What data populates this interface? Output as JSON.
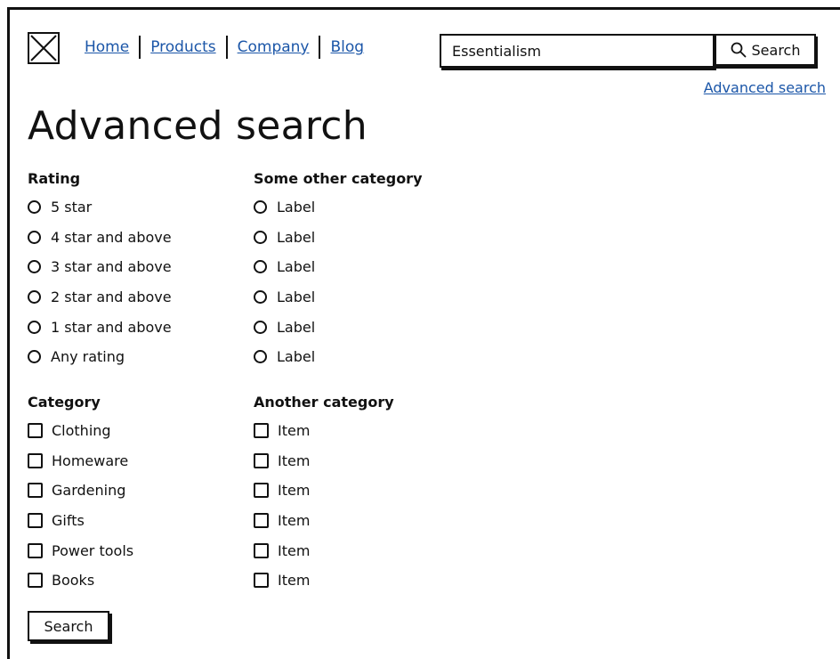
{
  "nav": {
    "items": [
      {
        "label": "Home"
      },
      {
        "label": "Products"
      },
      {
        "label": "Company"
      },
      {
        "label": "Blog"
      }
    ]
  },
  "search": {
    "value": "Essentialism",
    "button_label": "Search",
    "advanced_link": "Advanced search"
  },
  "page": {
    "title": "Advanced search"
  },
  "rating": {
    "title": "Rating",
    "options": [
      "5 star",
      "4 star and above",
      "3 star and above",
      "2 star and above",
      "1 star and above",
      "Any rating"
    ]
  },
  "other_category": {
    "title": "Some other category",
    "options": [
      "Label",
      "Label",
      "Label",
      "Label",
      "Label",
      "Label"
    ]
  },
  "category": {
    "title": "Category",
    "options": [
      "Clothing",
      "Homeware",
      "Gardening",
      "Gifts",
      "Power tools",
      "Books"
    ]
  },
  "another_category": {
    "title": "Another category",
    "options": [
      "Item",
      "Item",
      "Item",
      "Item",
      "Item",
      "Item"
    ]
  },
  "form": {
    "submit_label": "Search"
  },
  "icons": {
    "logo": "placeholder-x-icon",
    "search": "magnifier-icon",
    "radio": "radio-empty-icon",
    "checkbox": "checkbox-empty-icon"
  },
  "colors": {
    "link": "#1b56a8",
    "ink": "#111111",
    "background": "#ffffff"
  }
}
